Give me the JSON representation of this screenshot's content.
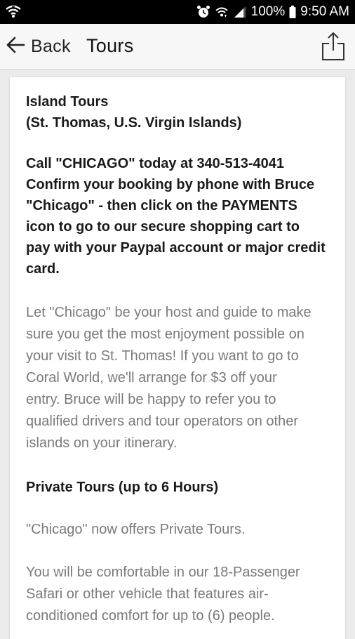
{
  "status_bar": {
    "battery": "100%",
    "time": "9:50 AM",
    "icons": [
      "wifi-calling-icon",
      "alarm-icon",
      "wifi-icon",
      "cellular-signal-icon",
      "battery-icon"
    ]
  },
  "app_bar": {
    "back_label": "Back",
    "title": "Tours",
    "icons": [
      "back-arrow-icon",
      "share-icon"
    ]
  },
  "content": {
    "title_line1": "Island Tours",
    "title_line2": "(St. Thomas, U.S. Virgin Islands)",
    "call_lines": [
      "Call \"CHICAGO\" today at 340-513-4041",
      "Confirm your booking by phone with Bruce",
      "\"Chicago\" - then click on the PAYMENTS",
      "icon to go to our secure shopping cart to",
      "pay with your Paypal account or major credit",
      "card."
    ],
    "intro_lines": [
      "Let \"Chicago\" be your host and guide to make",
      "sure you get the most enjoyment possible on",
      "your visit to St. Thomas! If you want to go to",
      "Coral World, we'll arrange for $3 off your",
      "entry. Bruce will be happy to refer you to",
      "qualified drivers and tour operators on other",
      "islands on your itinerary."
    ],
    "private_heading": "Private Tours (up to 6 Hours)",
    "private_text": "\"Chicago\" now offers Private Tours.",
    "comfort_lines": [
      "You will be comfortable in our 18-Passenger",
      "Safari or other vehicle that features air-",
      "conditioned comfort for up to (6) people."
    ]
  }
}
